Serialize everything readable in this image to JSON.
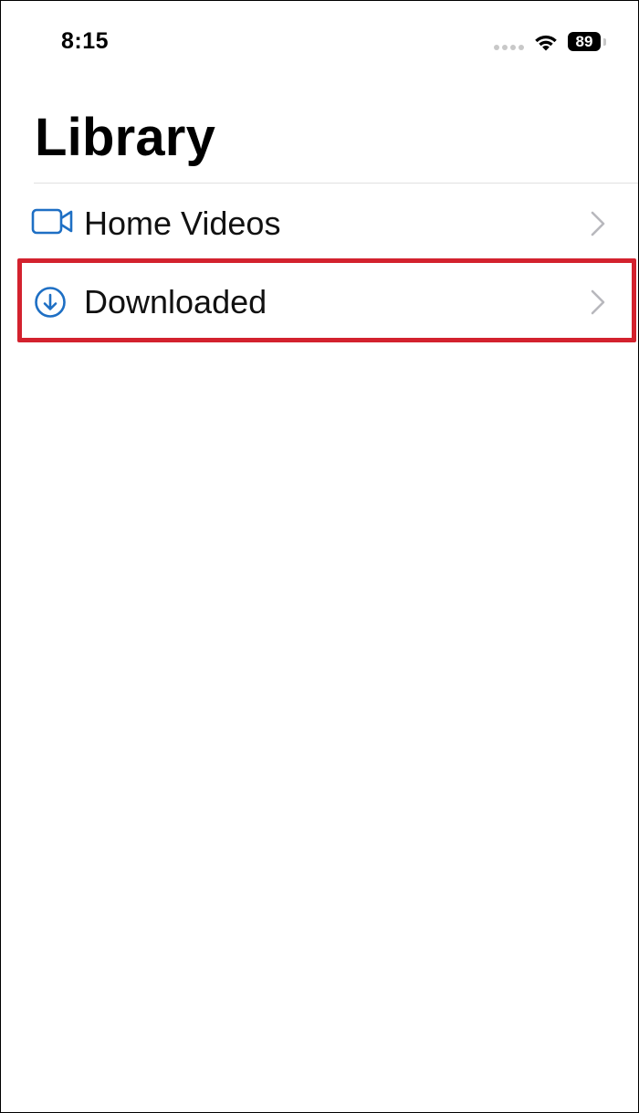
{
  "status_bar": {
    "time": "8:15",
    "battery_level": "89",
    "signal_icon": "cellular-signal-icon",
    "wifi_icon": "wifi-icon"
  },
  "header": {
    "title": "Library"
  },
  "library": {
    "items": [
      {
        "label": "Home Videos",
        "icon": "video-camera-icon"
      },
      {
        "label": "Downloaded",
        "icon": "download-circle-icon"
      }
    ]
  },
  "colors": {
    "accent": "#1e6fc4",
    "highlight_border": "#d3222e",
    "chevron": "#b8b8bd",
    "divider": "#e1e1e1"
  }
}
